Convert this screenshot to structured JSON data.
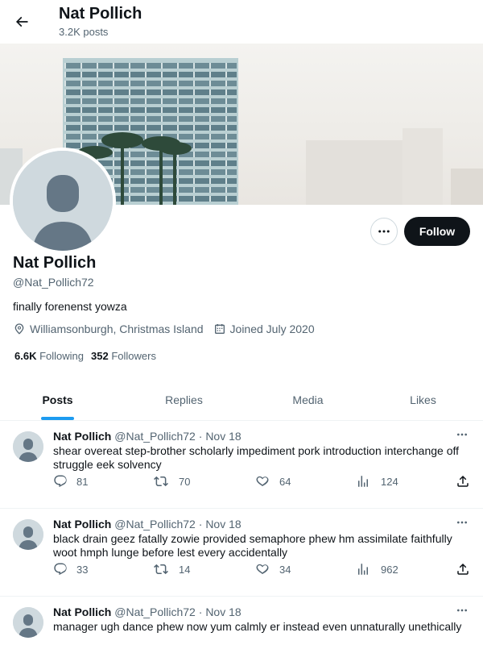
{
  "header": {
    "back_icon": "arrow-left-icon",
    "name": "Nat Pollich",
    "post_count": "3.2K posts"
  },
  "profile": {
    "name": "Nat Pollich",
    "handle": "@Nat_Pollich72",
    "bio": "finally forenenst yowza",
    "location": "Williamsonburgh, Christmas Island",
    "joined": "Joined July 2020",
    "following_count": "6.6K",
    "following_label": "Following",
    "followers_count": "352",
    "followers_label": "Followers",
    "follow_label": "Follow"
  },
  "tabs": [
    {
      "label": "Posts",
      "active": true
    },
    {
      "label": "Replies",
      "active": false
    },
    {
      "label": "Media",
      "active": false
    },
    {
      "label": "Likes",
      "active": false
    }
  ],
  "posts": [
    {
      "name": "Nat Pollich",
      "handle": "@Nat_Pollich72",
      "date": "Nov 18",
      "text": "shear overeat step-brother scholarly impediment pork introduction interchange off struggle eek solvency",
      "replies": "81",
      "reposts": "70",
      "likes": "64",
      "views": "124"
    },
    {
      "name": "Nat Pollich",
      "handle": "@Nat_Pollich72",
      "date": "Nov 18",
      "text": "black drain geez fatally zowie provided semaphore phew hm assimilate faithfully woot hmph lunge before lest every accidentally",
      "replies": "33",
      "reposts": "14",
      "likes": "34",
      "views": "962"
    },
    {
      "name": "Nat Pollich",
      "handle": "@Nat_Pollich72",
      "date": "Nov 18",
      "text": "manager ugh dance phew now yum calmly er instead even unnaturally unethically",
      "replies": "",
      "reposts": "",
      "likes": "",
      "views": ""
    }
  ],
  "colors": {
    "accent": "#1d9bf0",
    "text": "#0f1419",
    "muted": "#536471",
    "follow_bg": "#0f1419",
    "avatar_bg": "#cfd9de",
    "avatar_fg": "#657786"
  }
}
